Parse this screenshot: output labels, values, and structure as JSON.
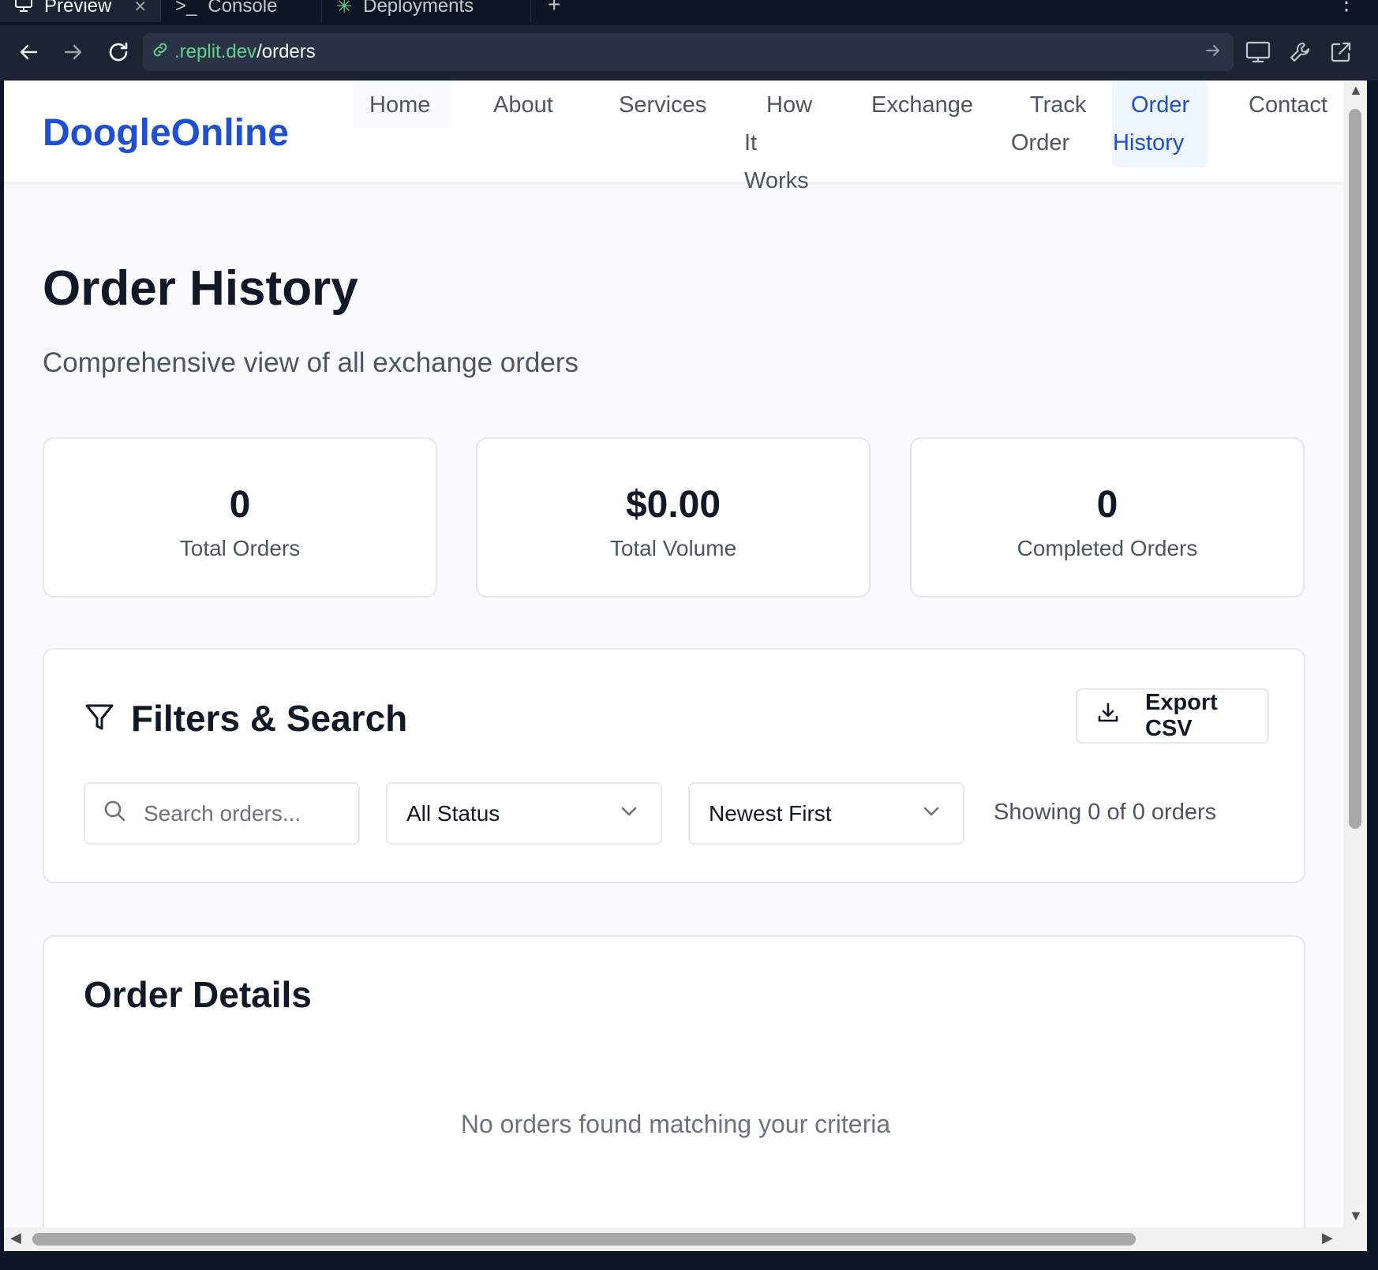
{
  "browser": {
    "tabs": [
      {
        "label": "Preview",
        "icon": "monitor-icon"
      },
      {
        "label": "Console",
        "icon": "terminal-icon"
      },
      {
        "label": "Deployments",
        "icon": "deploy-icon"
      }
    ],
    "url_domain": ".replit.dev",
    "url_path": "/orders",
    "accent_color": "#5fd38d"
  },
  "site": {
    "logo": "DoogleOnline",
    "brand_color": "#1d4ed8",
    "nav": [
      {
        "l1": "Home",
        "l2": "",
        "l3": ""
      },
      {
        "l1": "About",
        "l2": "",
        "l3": ""
      },
      {
        "l1": "Services",
        "l2": "",
        "l3": ""
      },
      {
        "l1": "How",
        "l2": "It",
        "l3": "Works"
      },
      {
        "l1": "Exchange",
        "l2": "",
        "l3": ""
      },
      {
        "l1": "Track",
        "l2": "Order",
        "l3": ""
      },
      {
        "l1": "Order",
        "l2": "History",
        "l3": ""
      },
      {
        "l1": "Contact",
        "l2": "",
        "l3": ""
      }
    ],
    "active_nav": "Order History"
  },
  "page": {
    "title": "Order History",
    "subtitle": "Comprehensive view of all exchange orders"
  },
  "stats": [
    {
      "value": "0",
      "label": "Total Orders"
    },
    {
      "value": "$0.00",
      "label": "Total Volume"
    },
    {
      "value": "0",
      "label": "Completed Orders"
    }
  ],
  "filters": {
    "title": "Filters & Search",
    "export_label": "Export CSV",
    "search_placeholder": "Search orders...",
    "status_selected": "All Status",
    "sort_selected": "Newest First",
    "showing_text": "Showing 0 of 0 orders"
  },
  "orders": {
    "title": "Order Details",
    "empty_message": "No orders found matching your criteria"
  }
}
